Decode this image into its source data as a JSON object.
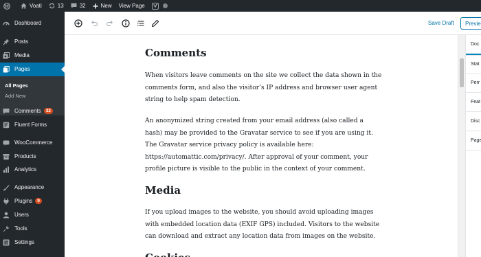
{
  "adminbar": {
    "site_name": "Voati",
    "updates_count": "13",
    "comments_count": "32",
    "new_label": "New",
    "view_page_label": "View Page"
  },
  "sidebar": {
    "dashboard": "Dashboard",
    "posts": "Posts",
    "media": "Media",
    "pages": "Pages",
    "all_pages": "All Pages",
    "add_new": "Add New",
    "comments": "Comments",
    "comments_badge": "32",
    "fluent_forms": "Fluent Forms",
    "woocommerce": "WooCommerce",
    "products": "Products",
    "analytics": "Analytics",
    "appearance": "Appearance",
    "plugins": "Plugins",
    "plugins_badge": "9",
    "users": "Users",
    "tools": "Tools",
    "settings": "Settings"
  },
  "toolbar": {
    "save_draft": "Save Draft",
    "preview": "Previe"
  },
  "content": {
    "heading_comments": "Comments",
    "para1": "When visitors leave comments on the site we collect the data shown in the comments form, and also the visitor’s IP address and browser user agent string to help spam detection.",
    "para2": "An anonymized string created from your email address (also called a hash) may be provided to the Gravatar service to see if you are using it. The Gravatar service privacy policy is available here: https://automattic.com/privacy/. After approval of your comment, your profile picture is visible to the public in the context of your comment.",
    "heading_media": "Media",
    "para3": "If you upload images to the website, you should avoid uploading images with embedded location data (EXIF GPS) included. Visitors to the website can download and extract any location data from images on the website.",
    "heading_cutoff": "Cookies"
  },
  "panel": {
    "tab_document": "Doc",
    "row_status": "Stat",
    "row_permalink": "Perr",
    "row_featured": "Feat",
    "row_discussion": "Disc",
    "row_page_attributes": "Page"
  },
  "colors": {
    "adminbar_bg": "#23282d",
    "sidebar_active": "#0073aa",
    "badge": "#d54e21",
    "link": "#0073aa"
  }
}
